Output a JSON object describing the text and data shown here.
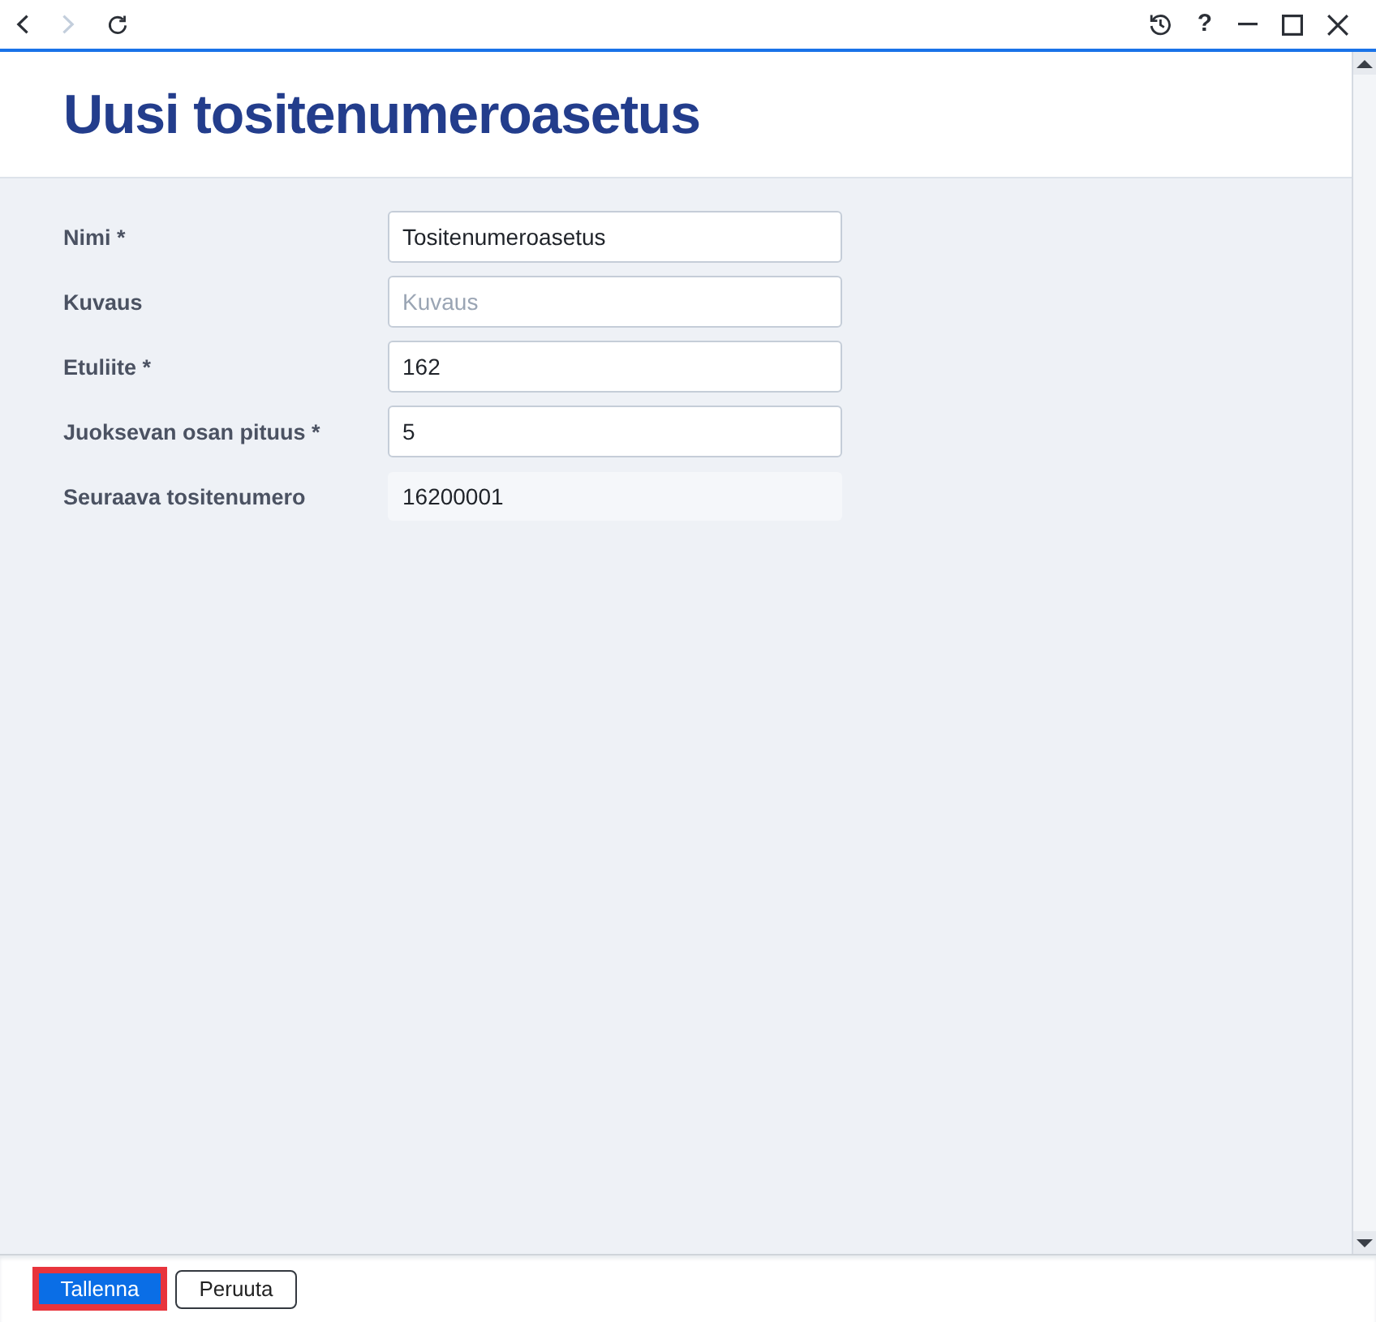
{
  "toolbar": {
    "nav": [
      {
        "kind": "back",
        "disabled": false
      },
      {
        "kind": "forward",
        "disabled": true
      },
      {
        "kind": "refresh",
        "disabled": false
      }
    ],
    "actions": [
      {
        "kind": "history"
      },
      {
        "kind": "help",
        "glyph": "?"
      },
      {
        "kind": "minimize"
      },
      {
        "kind": "maximize"
      },
      {
        "kind": "close"
      }
    ]
  },
  "header": {
    "title": "Uusi tositenumeroasetus"
  },
  "form": {
    "fields": [
      {
        "kind": "input",
        "label": "Nimi *",
        "value": "Tositenumeroasetus"
      },
      {
        "kind": "input",
        "label": "Kuvaus",
        "placeholder": "Kuvaus"
      },
      {
        "kind": "input",
        "label": "Etuliite *",
        "value": "162"
      },
      {
        "kind": "input",
        "label": "Juoksevan osan pituus *",
        "value": "5"
      },
      {
        "kind": "readonly",
        "label": "Seuraava tositenumero",
        "value": "16200001"
      }
    ]
  },
  "footer": {
    "buttons": [
      {
        "kind": "primary",
        "label": "Tallenna",
        "focused": true
      },
      {
        "kind": "secondary",
        "label": "Peruuta",
        "focused": false
      }
    ]
  }
}
